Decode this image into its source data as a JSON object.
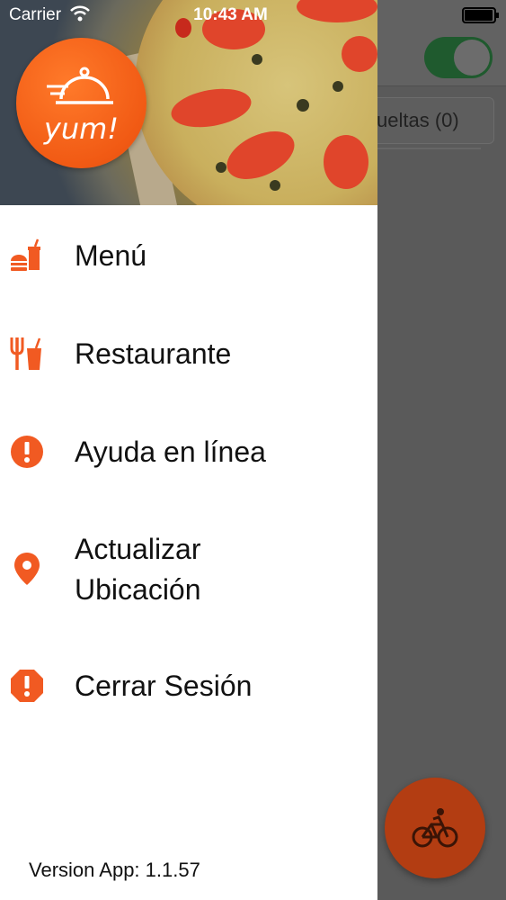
{
  "status_bar": {
    "carrier": "Carrier",
    "time": "10:43 AM"
  },
  "background": {
    "tab_label": "ueltas (0)"
  },
  "drawer": {
    "logo_text": "yum!",
    "items": [
      {
        "label": "Menú",
        "icon": "fastfood-icon"
      },
      {
        "label": "Restaurante",
        "icon": "cutlery-drink-icon"
      },
      {
        "label": "Ayuda en línea",
        "icon": "alert-circle-icon"
      },
      {
        "label": "Actualizar Ubicación",
        "label_line1": "Actualizar",
        "label_line2": "Ubicación",
        "icon": "location-pin-icon"
      },
      {
        "label": "Cerrar Sesión",
        "icon": "alert-octagon-icon"
      }
    ],
    "version": "Version App: 1.1.57"
  },
  "colors": {
    "accent": "#f15a22",
    "toggle": "#2e8b43"
  }
}
